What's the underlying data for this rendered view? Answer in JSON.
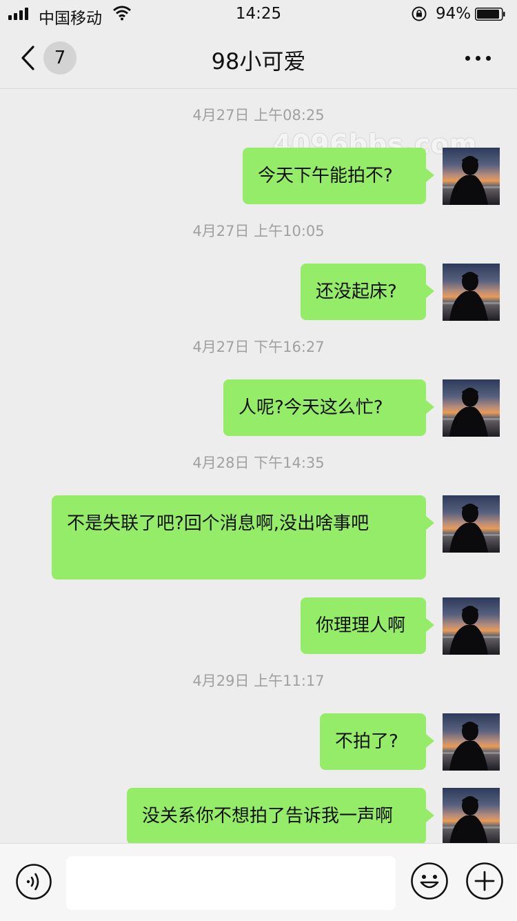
{
  "status_bar": {
    "carrier": "中国移动",
    "time": "14:25",
    "battery_percent": "94%",
    "battery_level": 0.94
  },
  "nav": {
    "unread_count": "7",
    "title": "98小可爱"
  },
  "watermark": "4096bbs.com",
  "chat": {
    "timestamps": [
      "4月27日 上午08:25",
      "4月27日 上午10:05",
      "4月27日 下午16:27",
      "4月28日 下午14:35",
      "4月29日 上午11:17"
    ],
    "messages": [
      {
        "text": "今天下午能拍不?",
        "sender": "me"
      },
      {
        "text": "还没起床?",
        "sender": "me"
      },
      {
        "text": "人呢?今天这么忙?",
        "sender": "me"
      },
      {
        "text": "不是失联了吧?回个消息啊,没出啥事吧",
        "sender": "me"
      },
      {
        "text": "你理理人啊",
        "sender": "me"
      },
      {
        "text": "不拍了?",
        "sender": "me"
      },
      {
        "text": "没关系你不想拍了告诉我一声啊",
        "sender": "me"
      }
    ]
  },
  "input_bar": {
    "text_value": "",
    "icons": [
      "voice-icon",
      "emoji-icon",
      "plus-icon"
    ]
  },
  "colors": {
    "background": "#ededed",
    "bubble": "#95ec69",
    "timestamp": "#a0a0a0"
  }
}
